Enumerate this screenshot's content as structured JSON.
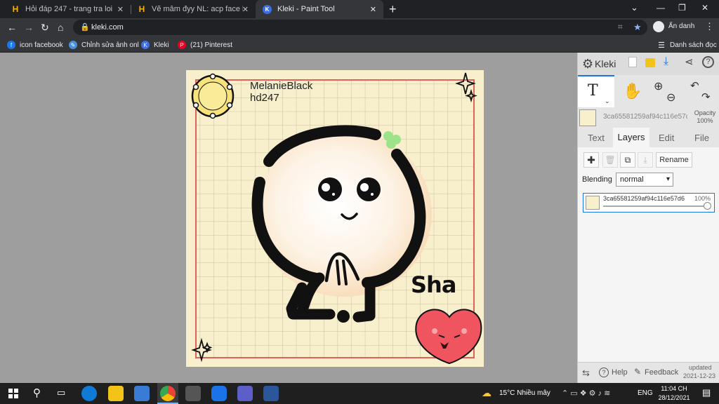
{
  "tabs": [
    {
      "title": "Hỏi đáp 247 - trang tra loi",
      "active": false
    },
    {
      "title": "Vẽ mâm đyy NL: acp face khum",
      "active": false
    },
    {
      "title": "Kleki - Paint Tool",
      "active": true
    }
  ],
  "new_tab_label": "+",
  "window_controls": {
    "minimize": "—",
    "restore": "❐",
    "close": "✕",
    "tab_menu": "⌄"
  },
  "address": {
    "url": "kleki.com",
    "profile_label": "Ẩn danh"
  },
  "bookmarks": [
    {
      "label": "icon facebook"
    },
    {
      "label": "Chỉnh sửa ảnh onl"
    },
    {
      "label": "Kleki"
    },
    {
      "label": "(21) Pinterest"
    }
  ],
  "reading_list": "Danh sách đọc",
  "drawing": {
    "text_top_line1": "MelanieBlack",
    "text_top_line2": "hd247",
    "signature": "Sha"
  },
  "kleki": {
    "logo": "Kleki",
    "layer_name_short": "3ca65581259af94c116e57d",
    "opacity_label": "Opacity",
    "opacity_value": "100%",
    "tabs": [
      "Text",
      "Layers",
      "Edit",
      "File"
    ],
    "active_tab": "Layers",
    "rename_label": "Rename",
    "blending_label": "Blending",
    "blending_value": "normal",
    "layer_row_name": "3ca65581259af94c116e57d6",
    "layer_row_opacity": "100%",
    "help_label": "Help",
    "feedback_label": "Feedback",
    "updated_label": "updated",
    "updated_date": "2021-12-23"
  },
  "taskbar": {
    "weather": "15°C  Nhiều mây",
    "lang": "ENG",
    "time": "11:04 CH",
    "date": "28/12/2021"
  }
}
